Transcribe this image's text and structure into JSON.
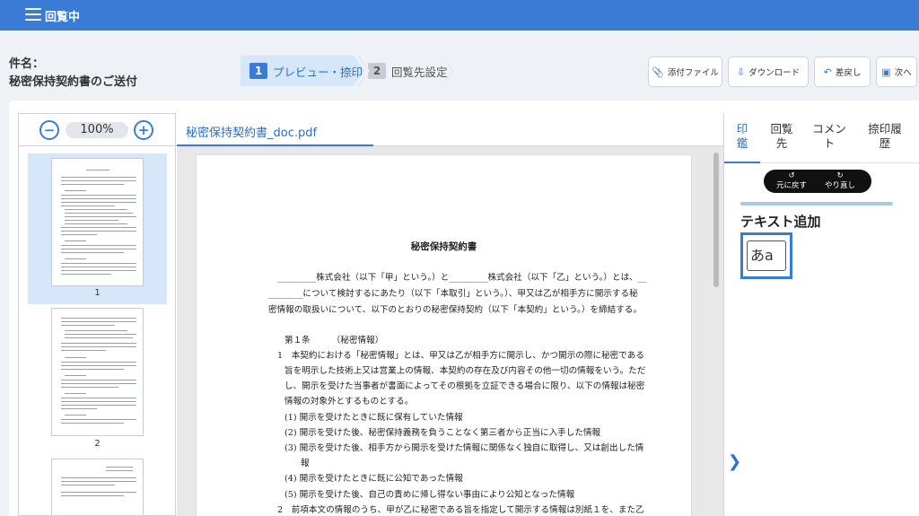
{
  "topbar": {
    "title": "回覧中"
  },
  "header": {
    "subject_label": "件名：",
    "subject_value": "秘密保持契約書のご送付"
  },
  "steps": [
    {
      "num": "1",
      "label": "プレビュー・捺印",
      "active": true
    },
    {
      "num": "2",
      "label": "回覧先設定",
      "active": false
    }
  ],
  "toolbar": {
    "attach": "添付ファイル",
    "download": "ダウンロード",
    "return": "差戻し",
    "next": "次へ"
  },
  "zoom": {
    "minus": "−",
    "value": "100%",
    "plus": "+"
  },
  "thumbnails": [
    {
      "page": "1",
      "selected": true
    },
    {
      "page": "2",
      "selected": false
    }
  ],
  "document": {
    "tab": "秘密保持契約書_doc.pdf",
    "title": "秘密保持契約書",
    "lines": [
      "_________株式会社（以下「甲」という。）と_________株式会社（以下「乙」という。）とは、__",
      "________について検討するにあたり（以下「本取引」という。）、甲又は乙が相手方に開示する秘",
      "密情報の取扱いについて、以下のとおりの秘密保持契約（以下「本契約」という。）を締結する。",
      "第１条　　　（秘密情報）",
      "1　本契約における「秘密情報」とは、甲又は乙が相手方に開示し、かつ開示の際に秘密である",
      "旨を明示した技術上又は営業上の情報、本契約の存在及び内容その他一切の情報をいう。ただ",
      "し、開示を受けた当事者が書面によってその根拠を立証できる場合に限り、以下の情報は秘密",
      "情報の対象外とするものとする。",
      "(1)  開示を受けたときに既に保有していた情報",
      "(2)  開示を受けた後、秘密保持義務を負うことなく第三者から正当に入手した情報",
      "(3)  開示を受けた後、相手方から開示を受けた情報に関係なく独自に取得し、又は創出した情",
      "報",
      "(4)  開示を受けたときに既に公知であった情報",
      "(5)  開示を受けた後、自己の責めに帰し得ない事由により公知となった情報",
      "2　前項本文の情報のうち、甲が乙に秘密である旨を指定して開示する情報は別紙１を、また乙"
    ]
  },
  "right_panel": {
    "tabs": [
      "印\n鑑",
      "回覧\n先",
      "コメン\nト",
      "捺印履\n歴"
    ],
    "undo": "元に戻す",
    "redo": "やり直し",
    "add_text_label": "テキスト追加",
    "add_text_icon": "あa"
  }
}
